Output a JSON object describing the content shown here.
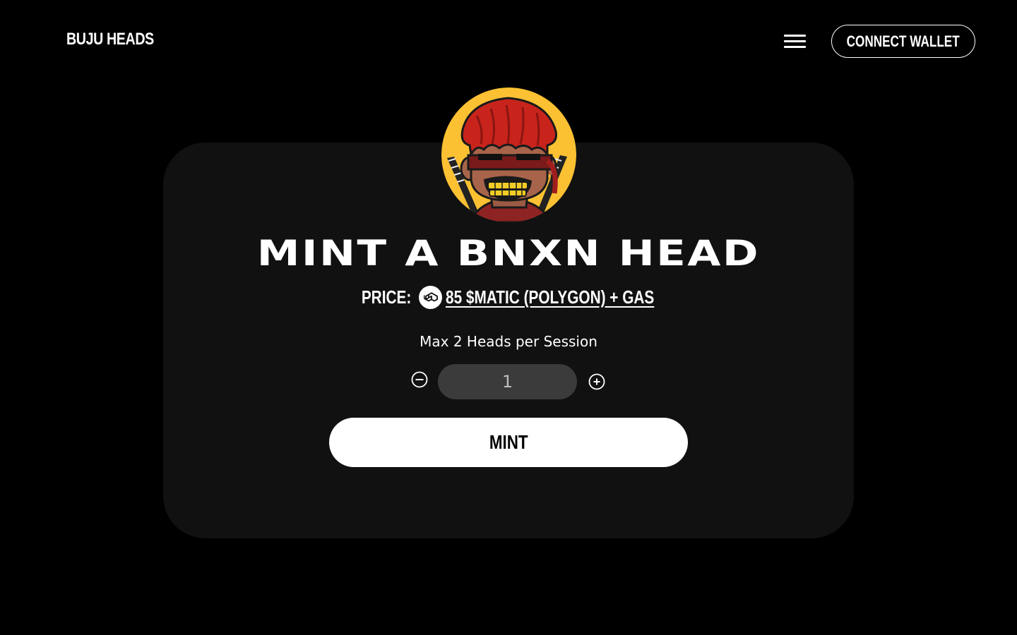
{
  "header": {
    "brand": "BUJU HEADS",
    "menu_icon": "hamburger-menu-icon",
    "connect_label": "CONNECT WALLET"
  },
  "mint": {
    "title": "MINT A BNXN HEAD",
    "price_label": "PRICE:",
    "price_icon": "polygon-matic-icon",
    "price_value": "85 $MATIC (POLYGON) + GAS",
    "max_text": "Max 2 Heads per Session",
    "quantity": "1",
    "decrement_icon": "minus-circle-icon",
    "increment_icon": "plus-circle-icon",
    "mint_label": "MINT"
  },
  "colors": {
    "background": "#000000",
    "card": "#111111",
    "avatar_bg": "#fcc133",
    "input_bg": "#3b3b3b",
    "button": "#ffffff"
  }
}
